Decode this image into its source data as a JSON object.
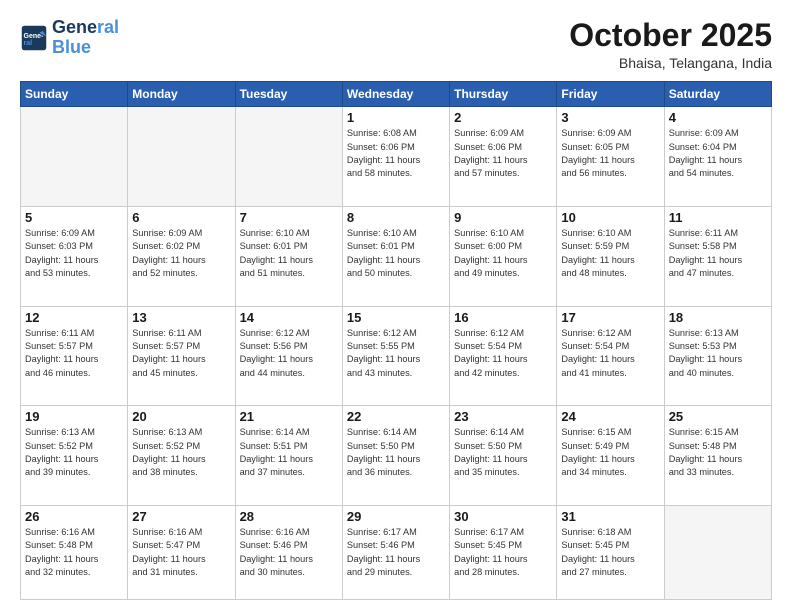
{
  "logo": {
    "line1": "General",
    "line2": "Blue"
  },
  "title": "October 2025",
  "subtitle": "Bhaisa, Telangana, India",
  "days_header": [
    "Sunday",
    "Monday",
    "Tuesday",
    "Wednesday",
    "Thursday",
    "Friday",
    "Saturday"
  ],
  "weeks": [
    [
      {
        "num": "",
        "info": ""
      },
      {
        "num": "",
        "info": ""
      },
      {
        "num": "",
        "info": ""
      },
      {
        "num": "1",
        "info": "Sunrise: 6:08 AM\nSunset: 6:06 PM\nDaylight: 11 hours\nand 58 minutes."
      },
      {
        "num": "2",
        "info": "Sunrise: 6:09 AM\nSunset: 6:06 PM\nDaylight: 11 hours\nand 57 minutes."
      },
      {
        "num": "3",
        "info": "Sunrise: 6:09 AM\nSunset: 6:05 PM\nDaylight: 11 hours\nand 56 minutes."
      },
      {
        "num": "4",
        "info": "Sunrise: 6:09 AM\nSunset: 6:04 PM\nDaylight: 11 hours\nand 54 minutes."
      }
    ],
    [
      {
        "num": "5",
        "info": "Sunrise: 6:09 AM\nSunset: 6:03 PM\nDaylight: 11 hours\nand 53 minutes."
      },
      {
        "num": "6",
        "info": "Sunrise: 6:09 AM\nSunset: 6:02 PM\nDaylight: 11 hours\nand 52 minutes."
      },
      {
        "num": "7",
        "info": "Sunrise: 6:10 AM\nSunset: 6:01 PM\nDaylight: 11 hours\nand 51 minutes."
      },
      {
        "num": "8",
        "info": "Sunrise: 6:10 AM\nSunset: 6:01 PM\nDaylight: 11 hours\nand 50 minutes."
      },
      {
        "num": "9",
        "info": "Sunrise: 6:10 AM\nSunset: 6:00 PM\nDaylight: 11 hours\nand 49 minutes."
      },
      {
        "num": "10",
        "info": "Sunrise: 6:10 AM\nSunset: 5:59 PM\nDaylight: 11 hours\nand 48 minutes."
      },
      {
        "num": "11",
        "info": "Sunrise: 6:11 AM\nSunset: 5:58 PM\nDaylight: 11 hours\nand 47 minutes."
      }
    ],
    [
      {
        "num": "12",
        "info": "Sunrise: 6:11 AM\nSunset: 5:57 PM\nDaylight: 11 hours\nand 46 minutes."
      },
      {
        "num": "13",
        "info": "Sunrise: 6:11 AM\nSunset: 5:57 PM\nDaylight: 11 hours\nand 45 minutes."
      },
      {
        "num": "14",
        "info": "Sunrise: 6:12 AM\nSunset: 5:56 PM\nDaylight: 11 hours\nand 44 minutes."
      },
      {
        "num": "15",
        "info": "Sunrise: 6:12 AM\nSunset: 5:55 PM\nDaylight: 11 hours\nand 43 minutes."
      },
      {
        "num": "16",
        "info": "Sunrise: 6:12 AM\nSunset: 5:54 PM\nDaylight: 11 hours\nand 42 minutes."
      },
      {
        "num": "17",
        "info": "Sunrise: 6:12 AM\nSunset: 5:54 PM\nDaylight: 11 hours\nand 41 minutes."
      },
      {
        "num": "18",
        "info": "Sunrise: 6:13 AM\nSunset: 5:53 PM\nDaylight: 11 hours\nand 40 minutes."
      }
    ],
    [
      {
        "num": "19",
        "info": "Sunrise: 6:13 AM\nSunset: 5:52 PM\nDaylight: 11 hours\nand 39 minutes."
      },
      {
        "num": "20",
        "info": "Sunrise: 6:13 AM\nSunset: 5:52 PM\nDaylight: 11 hours\nand 38 minutes."
      },
      {
        "num": "21",
        "info": "Sunrise: 6:14 AM\nSunset: 5:51 PM\nDaylight: 11 hours\nand 37 minutes."
      },
      {
        "num": "22",
        "info": "Sunrise: 6:14 AM\nSunset: 5:50 PM\nDaylight: 11 hours\nand 36 minutes."
      },
      {
        "num": "23",
        "info": "Sunrise: 6:14 AM\nSunset: 5:50 PM\nDaylight: 11 hours\nand 35 minutes."
      },
      {
        "num": "24",
        "info": "Sunrise: 6:15 AM\nSunset: 5:49 PM\nDaylight: 11 hours\nand 34 minutes."
      },
      {
        "num": "25",
        "info": "Sunrise: 6:15 AM\nSunset: 5:48 PM\nDaylight: 11 hours\nand 33 minutes."
      }
    ],
    [
      {
        "num": "26",
        "info": "Sunrise: 6:16 AM\nSunset: 5:48 PM\nDaylight: 11 hours\nand 32 minutes."
      },
      {
        "num": "27",
        "info": "Sunrise: 6:16 AM\nSunset: 5:47 PM\nDaylight: 11 hours\nand 31 minutes."
      },
      {
        "num": "28",
        "info": "Sunrise: 6:16 AM\nSunset: 5:46 PM\nDaylight: 11 hours\nand 30 minutes."
      },
      {
        "num": "29",
        "info": "Sunrise: 6:17 AM\nSunset: 5:46 PM\nDaylight: 11 hours\nand 29 minutes."
      },
      {
        "num": "30",
        "info": "Sunrise: 6:17 AM\nSunset: 5:45 PM\nDaylight: 11 hours\nand 28 minutes."
      },
      {
        "num": "31",
        "info": "Sunrise: 6:18 AM\nSunset: 5:45 PM\nDaylight: 11 hours\nand 27 minutes."
      },
      {
        "num": "",
        "info": ""
      }
    ]
  ]
}
